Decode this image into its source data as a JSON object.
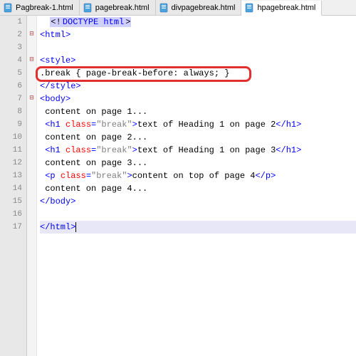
{
  "tabs": [
    {
      "label": "Pagbreak-1.html",
      "active": false
    },
    {
      "label": "pagebreak.html",
      "active": false
    },
    {
      "label": "divpagebreak.html",
      "active": false
    },
    {
      "label": "hpagebreak.html",
      "active": true
    }
  ],
  "gutter_count": 17,
  "fold_marks": {
    "2": "⊟",
    "4": "⊟",
    "7": "⊟"
  },
  "code": {
    "l1_a": "<!",
    "l1_b": "DOCTYPE html",
    "l1_c": ">",
    "l2": "<html>",
    "l3": "",
    "l4": "<style>",
    "l5": ".break { page-break-before: always; }",
    "l6": "</style>",
    "l7": "<body>",
    "l8": " content on page 1...",
    "l9_t1": " <h1 ",
    "l9_a": "class",
    "l9_eq": "=",
    "l9_v": "\"break\"",
    "l9_t1c": ">",
    "l9_txt": "text of Heading 1 on page 2",
    "l9_t2": "</h1>",
    "l10": " content on page 2...",
    "l11_t1": " <h1 ",
    "l11_a": "class",
    "l11_eq": "=",
    "l11_v": "\"break\"",
    "l11_t1c": ">",
    "l11_txt": "text of Heading 1 on page 3",
    "l11_t2": "</h1>",
    "l12": " content on page 3...",
    "l13_t1": " <p ",
    "l13_a": "class",
    "l13_eq": "=",
    "l13_v": "\"break\"",
    "l13_t1c": ">",
    "l13_txt": "content on top of page 4",
    "l13_t2": "</p>",
    "l14": " content on page 4...",
    "l15": "</body>",
    "l16": "",
    "l17": "</html>"
  }
}
